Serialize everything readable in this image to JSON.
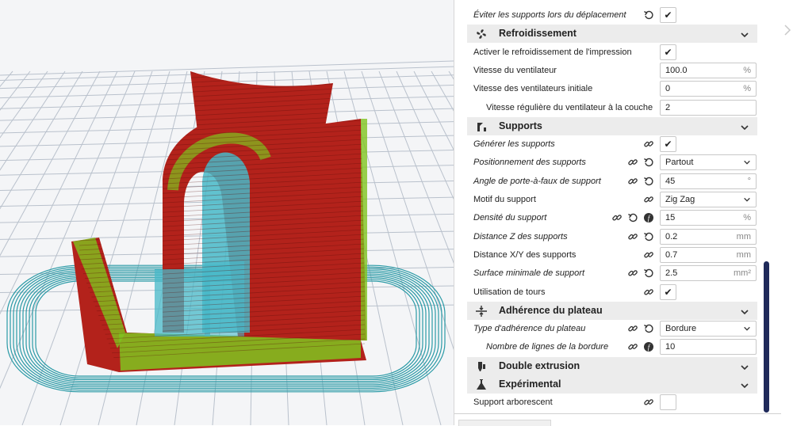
{
  "viewport": {
    "model_colors": {
      "wall": "#b3221b",
      "infill": "#7fc41e",
      "support": "#47b8c8",
      "skirt": "#2a9aa6",
      "grid": "#b9c1cc"
    }
  },
  "panel": {
    "rows": [
      {
        "label": "Éviter les supports lors du déplacement",
        "italic": true,
        "icons": [
          "reset-icon"
        ],
        "control": "checkbox",
        "checked": true
      },
      {
        "section": true,
        "icon": "fan-icon",
        "title": "Refroidissement"
      },
      {
        "label": "Activer le refroidissement de l'impression",
        "icons": [],
        "control": "checkbox",
        "checked": true
      },
      {
        "label": "Vitesse du ventilateur",
        "icons": [],
        "control": "input",
        "value": "100.0",
        "unit": "%"
      },
      {
        "label": "Vitesse des ventilateurs initiale",
        "icons": [],
        "control": "input",
        "value": "0",
        "unit": "%"
      },
      {
        "label": "Vitesse régulière du ventilateur à la couche",
        "sub": true,
        "icons": [],
        "control": "input",
        "value": "2",
        "unit": ""
      },
      {
        "section": true,
        "icon": "supports-icon",
        "title": "Supports"
      },
      {
        "label": "Générer les supports",
        "italic": true,
        "icons": [
          "link-icon"
        ],
        "control": "checkbox",
        "checked": true
      },
      {
        "label": "Positionnement des supports",
        "italic": true,
        "icons": [
          "link-icon",
          "reset-icon"
        ],
        "control": "select",
        "value": "Partout"
      },
      {
        "label": "Angle de porte-à-faux de support",
        "italic": true,
        "icons": [
          "link-icon",
          "reset-icon"
        ],
        "control": "input",
        "value": "45",
        "unit": "°"
      },
      {
        "label": "Motif du support",
        "icons": [
          "link-icon"
        ],
        "control": "select",
        "value": "Zig Zag"
      },
      {
        "label": "Densité du support",
        "italic": true,
        "icons": [
          "link-icon",
          "reset-icon",
          "function-icon"
        ],
        "control": "input",
        "value": "15",
        "unit": "%"
      },
      {
        "label": "Distance Z des supports",
        "italic": true,
        "icons": [
          "link-icon",
          "reset-icon"
        ],
        "control": "input",
        "value": "0.2",
        "unit": "mm"
      },
      {
        "label": "Distance X/Y des supports",
        "icons": [
          "link-icon"
        ],
        "control": "input",
        "value": "0.7",
        "unit": "mm"
      },
      {
        "label": "Surface minimale de support",
        "italic": true,
        "icons": [
          "link-icon",
          "reset-icon"
        ],
        "control": "input",
        "value": "2.5",
        "unit": "mm²"
      },
      {
        "label": "Utilisation de tours",
        "icons": [
          "link-icon"
        ],
        "control": "checkbox",
        "checked": true
      },
      {
        "section": true,
        "icon": "adhesion-icon",
        "title": "Adhérence du plateau"
      },
      {
        "label": "Type d'adhérence du plateau",
        "italic": true,
        "icons": [
          "link-icon",
          "reset-icon"
        ],
        "control": "select",
        "value": "Bordure"
      },
      {
        "label": "Nombre de lignes de la bordure",
        "italic": true,
        "sub": true,
        "icons": [
          "link-icon",
          "function-icon"
        ],
        "control": "input",
        "value": "10",
        "unit": ""
      },
      {
        "section": true,
        "icon": "dual-extrusion-icon",
        "title": "Double extrusion"
      },
      {
        "section": true,
        "icon": "experimental-icon",
        "title": "Expérimental"
      },
      {
        "label": "Support arborescent",
        "icons": [
          "link-icon"
        ],
        "control": "checkbox",
        "checked": false
      }
    ]
  }
}
